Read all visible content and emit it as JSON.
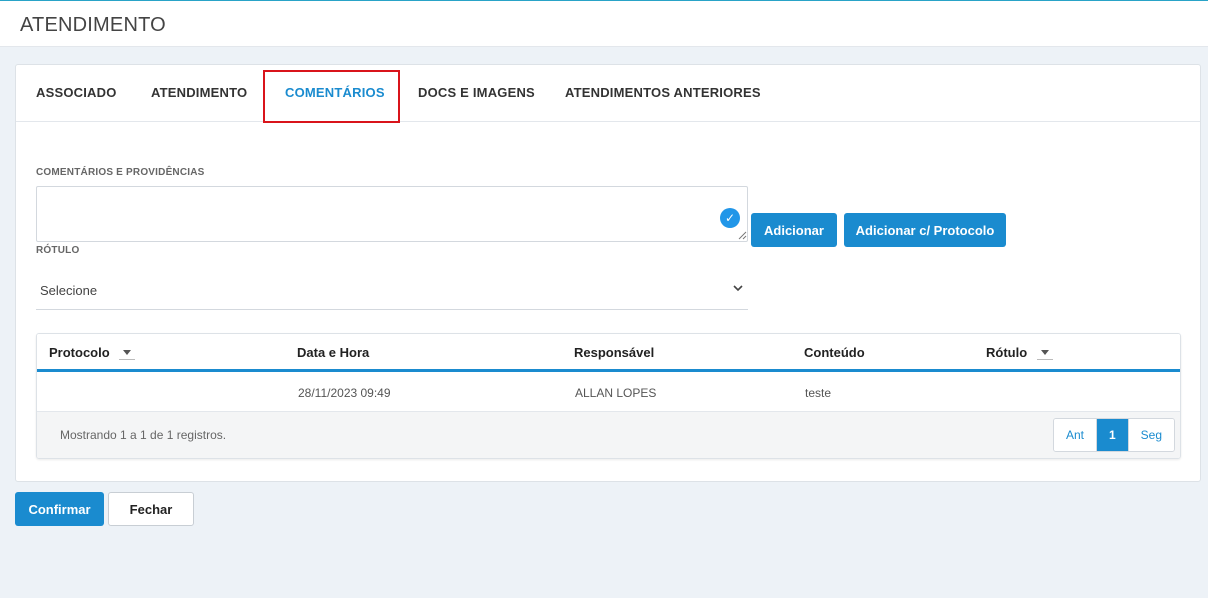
{
  "header": {
    "title": "ATENDIMENTO"
  },
  "tabs": [
    {
      "label": "ASSOCIADO"
    },
    {
      "label": "ATENDIMENTO"
    },
    {
      "label": "COMENTÁRIOS"
    },
    {
      "label": "DOCS E IMAGENS"
    },
    {
      "label": "ATENDIMENTOS ANTERIORES"
    }
  ],
  "active_tab": "COMENTÁRIOS",
  "form": {
    "comments_label": "COMENTÁRIOS E PROVIDÊNCIAS",
    "comments_value": "",
    "rotulo_label": "RÓTULO",
    "rotulo_selected": "Selecione",
    "add_label": "Adicionar",
    "add_protocol_label": "Adicionar c/ Protocolo"
  },
  "table": {
    "columns": [
      "Protocolo",
      "Data e Hora",
      "Responsável",
      "Conteúdo",
      "Rótulo"
    ],
    "rows": [
      {
        "protocolo": "",
        "data_hora": "28/11/2023 09:49",
        "responsavel": "ALLAN LOPES",
        "conteudo": "teste",
        "rotulo": ""
      }
    ],
    "info": "Mostrando 1 a 1 de 1 registros.",
    "pager": {
      "prev": "Ant",
      "current": "1",
      "next": "Seg"
    }
  },
  "actions": {
    "confirm_label": "Confirmar",
    "close_label": "Fechar"
  },
  "colors": {
    "accent": "#1a8bcf",
    "highlight": "#d9141b",
    "check": "#2196e8"
  },
  "icons": [
    "check-circle-icon",
    "chevron-down-icon",
    "sort-caret-icon",
    "resize-grip-icon"
  ]
}
